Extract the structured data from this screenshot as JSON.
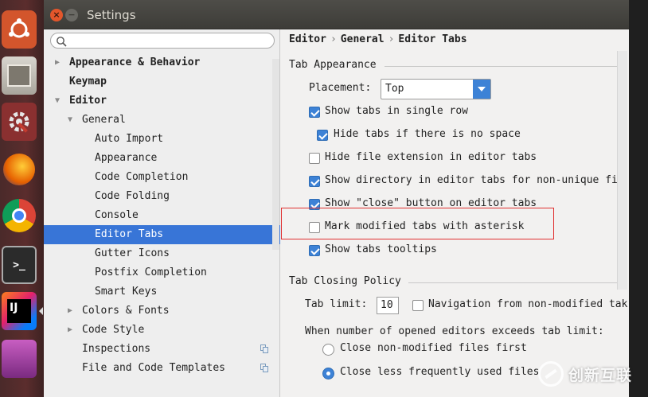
{
  "window": {
    "title": "Settings",
    "close_glyph": "×",
    "min_glyph": "−"
  },
  "launcher": {
    "items": [
      {
        "name": "ubuntu-dash-icon"
      },
      {
        "name": "files-icon"
      },
      {
        "name": "system-settings-icon"
      },
      {
        "name": "firefox-icon"
      },
      {
        "name": "chrome-icon"
      },
      {
        "name": "terminal-icon"
      },
      {
        "name": "intellij-idea-icon",
        "label": "IJ"
      },
      {
        "name": "workspace-icon"
      }
    ]
  },
  "tree": {
    "search_placeholder": "",
    "items": [
      {
        "label": "Appearance & Behavior",
        "bold": true,
        "arrow": "▶"
      },
      {
        "label": "Keymap",
        "bold": true
      },
      {
        "label": "Editor",
        "bold": true,
        "arrow": "▼"
      },
      {
        "label": "General",
        "arrow": "▼"
      },
      {
        "label": "Auto Import"
      },
      {
        "label": "Appearance"
      },
      {
        "label": "Code Completion"
      },
      {
        "label": "Code Folding"
      },
      {
        "label": "Console"
      },
      {
        "label": "Editor Tabs",
        "selected": true
      },
      {
        "label": "Gutter Icons"
      },
      {
        "label": "Postfix Completion"
      },
      {
        "label": "Smart Keys"
      },
      {
        "label": "Colors & Fonts",
        "arrow": "▶"
      },
      {
        "label": "Code Style",
        "arrow": "▶"
      },
      {
        "label": "Inspections"
      },
      {
        "label": "File and Code Templates"
      }
    ]
  },
  "breadcrumb": {
    "parts": [
      "Editor",
      "General",
      "Editor Tabs"
    ],
    "sep": "›"
  },
  "tab_appearance": {
    "header": "Tab Appearance",
    "placement_label": "Placement:",
    "placement_value": "Top",
    "options": [
      {
        "label": "Show tabs in single row",
        "checked": true
      },
      {
        "label": "Hide tabs if there is no space",
        "checked": true
      },
      {
        "label": "Hide file extension in editor tabs",
        "checked": false
      },
      {
        "label": "Show directory in editor tabs for non-unique fil",
        "checked": true
      },
      {
        "label": "Show \"close\" button on editor tabs",
        "checked": true
      },
      {
        "label": "Mark modified tabs with asterisk",
        "checked": false
      },
      {
        "label": "Show tabs tooltips",
        "checked": true
      }
    ]
  },
  "tab_closing": {
    "header": "Tab Closing Policy",
    "limit_label": "Tab limit:",
    "limit_value": "10",
    "nav_label": "Navigation from non-modified tak",
    "nav_checked": false,
    "exceeds_label": "When number of opened editors exceeds tab limit:",
    "radios": [
      {
        "label": "Close non-modified files first",
        "selected": false
      },
      {
        "label": "Close less frequently used files",
        "selected": true
      }
    ]
  },
  "watermark": {
    "text": "创新互联"
  },
  "colors": {
    "selection": "#3875d7",
    "accent": "#3d82d6",
    "highlight_border": "#e03030"
  }
}
